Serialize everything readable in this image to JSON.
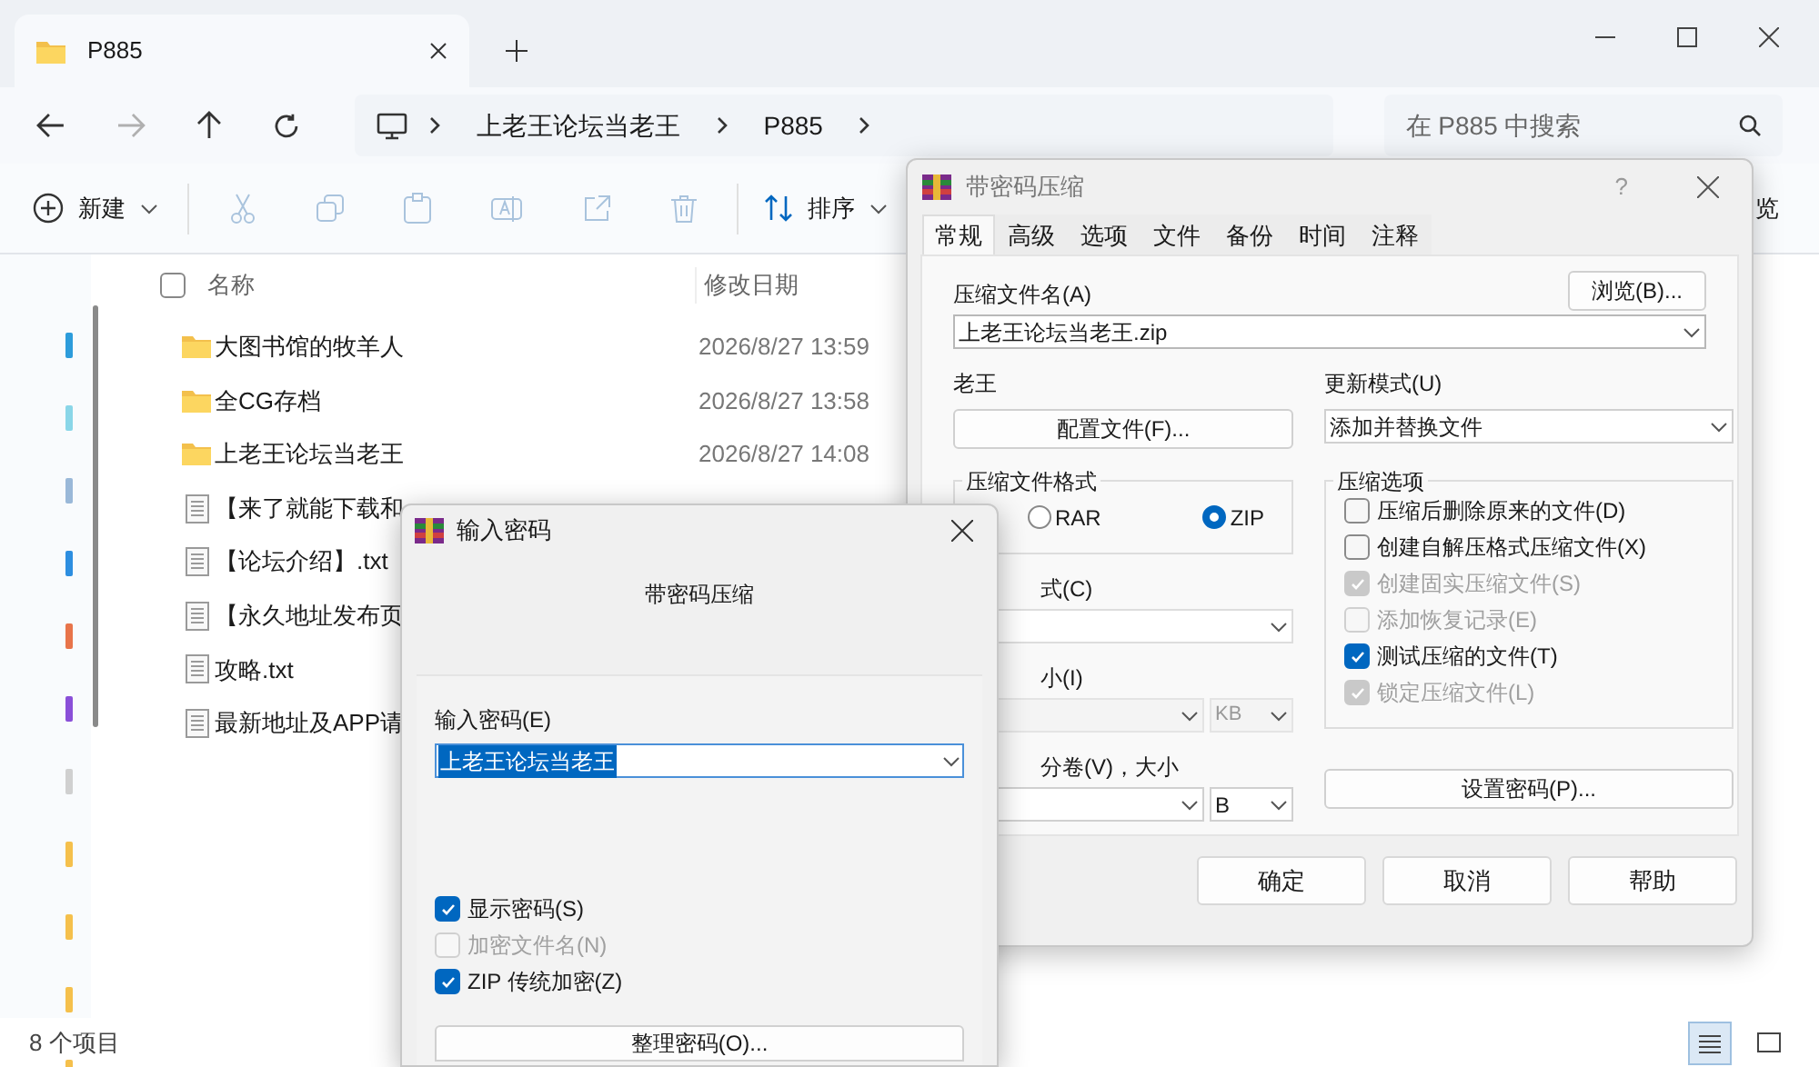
{
  "explorer": {
    "tab_title": "P885",
    "breadcrumbs": [
      "上老王论坛当老王",
      "P885"
    ],
    "search_placeholder": "在 P885 中搜索",
    "toolbar": {
      "new": "新建",
      "sort": "排序",
      "view": "览"
    },
    "columns": [
      "名称",
      "修改日期"
    ],
    "select_all_checked": false,
    "files": [
      {
        "kind": "folder",
        "name": "大图书馆的牧羊人",
        "modified": "2026/8/27 13:59"
      },
      {
        "kind": "folder",
        "name": "全CG存档",
        "modified": "2026/8/27 13:58"
      },
      {
        "kind": "folder",
        "name": "上老王论坛当老王",
        "modified": "2026/8/27 14:08"
      },
      {
        "kind": "file",
        "name": "【来了就能下载和"
      },
      {
        "kind": "file",
        "name": "【论坛介绍】.txt"
      },
      {
        "kind": "file",
        "name": "【永久地址发布页"
      },
      {
        "kind": "file",
        "name": "攻略.txt"
      },
      {
        "kind": "file",
        "name": "最新地址及APP请"
      }
    ],
    "status": "8 个项目"
  },
  "archive_dialog": {
    "title": "带密码压缩",
    "help": "?",
    "tabs": [
      {
        "label": "常规",
        "selected": true
      },
      {
        "label": "高级",
        "selected": false
      },
      {
        "label": "选项",
        "selected": false
      },
      {
        "label": "文件",
        "selected": false
      },
      {
        "label": "备份",
        "selected": false
      },
      {
        "label": "时间",
        "selected": false
      },
      {
        "label": "注释",
        "selected": false
      }
    ],
    "archive_name_label": "压缩文件名(A)",
    "browse_button": "浏览(B)...",
    "archive_name": "上老王论坛当老王.zip",
    "profile_label": "老王",
    "profile_button": "配置文件(F)...",
    "update_mode_label": "更新模式(U)",
    "update_mode": "添加并替换文件",
    "format_label": "压缩文件格式",
    "formats": [
      {
        "label": "RAR",
        "selected": false
      },
      {
        "label": "ZIP",
        "selected": true
      }
    ],
    "method_label": "式(C)",
    "size_label": "小(I)",
    "size_unit": "KB",
    "volume_label": "分卷(V)，大小",
    "volume_unit": "B",
    "options_label": "压缩选项",
    "options": [
      {
        "label": "压缩后删除原来的文件(D)",
        "checked": false,
        "disabled": false
      },
      {
        "label": "创建自解压格式压缩文件(X)",
        "checked": false,
        "disabled": false
      },
      {
        "label": "创建固实压缩文件(S)",
        "checked": true,
        "disabled": true
      },
      {
        "label": "添加恢复记录(E)",
        "checked": false,
        "disabled": true
      },
      {
        "label": "测试压缩的文件(T)",
        "checked": true,
        "disabled": false
      },
      {
        "label": "锁定压缩文件(L)",
        "checked": true,
        "disabled": true
      }
    ],
    "set_password_button": "设置密码(P)...",
    "buttons": [
      "确定",
      "取消",
      "帮助"
    ]
  },
  "password_dialog": {
    "title": "输入密码",
    "subtitle": "带密码压缩",
    "password_label": "输入密码(E)",
    "password": "上老王论坛当老王",
    "options": [
      {
        "label": "显示密码(S)",
        "checked": true,
        "disabled": false
      },
      {
        "label": "加密文件名(N)",
        "checked": false,
        "disabled": true
      },
      {
        "label": "ZIP 传统加密(Z)",
        "checked": true,
        "disabled": false
      }
    ],
    "organize_button": "整理密码(O)..."
  }
}
